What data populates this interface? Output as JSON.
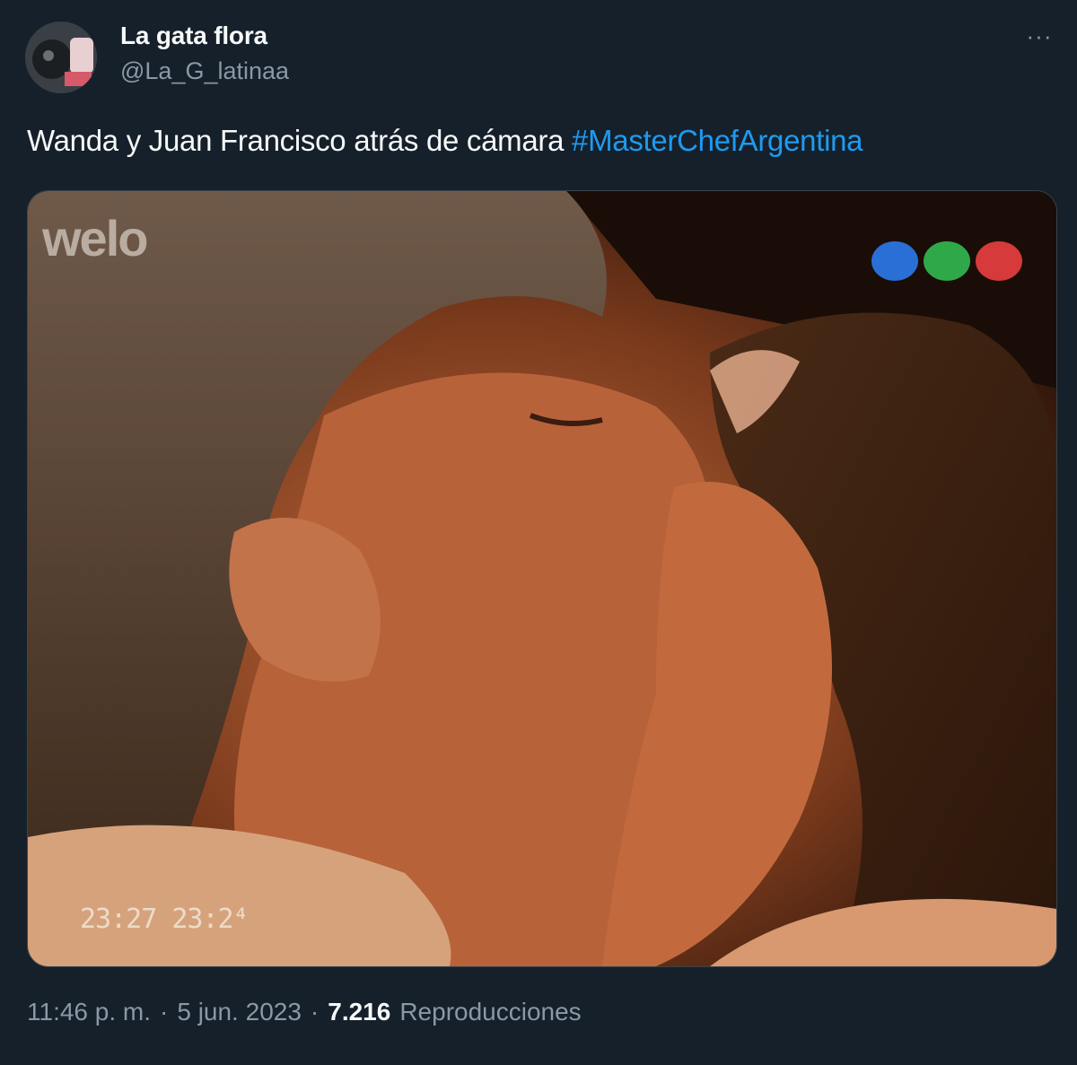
{
  "user": {
    "display_name": "La gata flora",
    "handle": "@La_G_latinaa",
    "avatar_icon": "profile-avatar"
  },
  "more_icon": "more-options-icon",
  "more_glyph": "···",
  "tweet": {
    "text": "Wanda y Juan Francisco atrás de cámara",
    "hashtag": "#MasterChefArgentina",
    "hashtag_color": "#1d9bf0"
  },
  "media": {
    "watermark": "welo",
    "timestamp_overlay": "23:27  23:2⁴",
    "channel_dots": [
      "#2a6fd6",
      "#2fa84a",
      "#d63a3a"
    ]
  },
  "meta": {
    "time": "11:46 p. m.",
    "separator": "·",
    "date": "5 jun. 2023",
    "views_count": "7.216",
    "views_label": "Reproducciones"
  },
  "colors": {
    "background": "#15202b",
    "text": "#f7f9f9",
    "secondary": "#8b98a5"
  }
}
